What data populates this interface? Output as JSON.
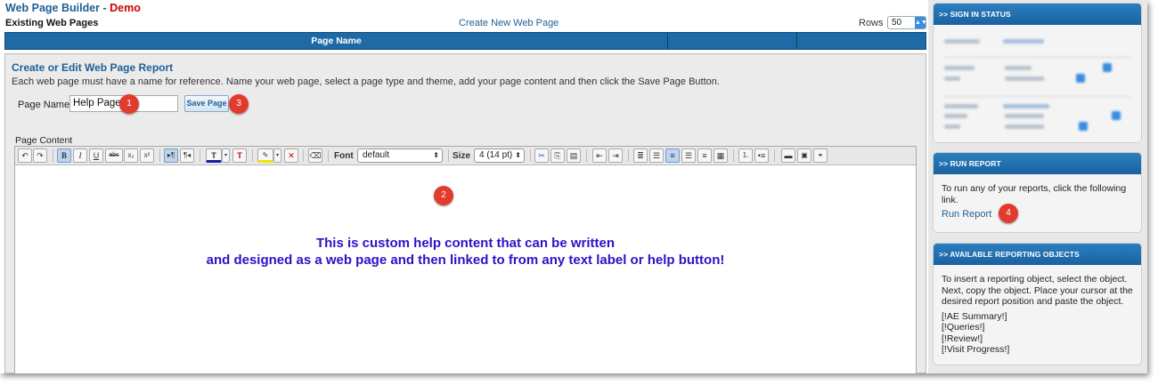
{
  "app": {
    "title": "Web Page Builder",
    "title_sep": " - ",
    "demo_label": "Demo"
  },
  "header": {
    "existing_label": "Existing Web Pages",
    "create_link": "Create New Web Page",
    "rows_label": "Rows",
    "rows_value": "50"
  },
  "table": {
    "columns": [
      "Page Name",
      "",
      ""
    ]
  },
  "panel": {
    "title": "Create or Edit Web Page Report",
    "description": "Each web page must have a name for reference. Name your web page, select a page type and theme, add your page content and then click the Save Page Button.",
    "page_name_label": "Page Name",
    "page_name_value": "Help Page",
    "save_button": "Save Page",
    "page_content_label": "Page Content"
  },
  "editor": {
    "font_label": "Font",
    "font_value": "default",
    "size_label": "Size",
    "size_value": "4 (14 pt)",
    "content_line1": "This is custom help content that can be written",
    "content_line2": "and designed as a web page and then linked to from any text label or help button!"
  },
  "badges": {
    "b1": "1",
    "b2": "2",
    "b3": "3",
    "b4": "4"
  },
  "sidebar": {
    "signin": {
      "title": ">> SIGN IN STATUS"
    },
    "run_report": {
      "title": ">> RUN REPORT",
      "text": "To run any of your reports, click the following link.",
      "link": "Run Report"
    },
    "objects": {
      "title": ">> AVAILABLE REPORTING OBJECTS",
      "text": "To insert a reporting object, select the object. Next, copy the object. Place your cursor at the desired report position and paste the object.",
      "items": [
        "[!AE Summary!]",
        "[!Queries!]",
        "[!Review!]",
        "[!Visit Progress!]"
      ]
    }
  },
  "colors": {
    "brand_blue": "#1e5f96",
    "header_bar": "#1e6aa6",
    "demo_red": "#d00000",
    "badge_red": "#e23b2e",
    "content_text": "#2a12c8"
  },
  "icons": [
    "undo-icon",
    "redo-icon",
    "bold-icon",
    "italic-icon",
    "underline-icon",
    "strikethrough-icon",
    "subscript-icon",
    "superscript-icon",
    "ltr-icon",
    "rtl-icon",
    "text-color-icon",
    "remove-text-color-icon",
    "highlight-icon",
    "remove-highlight-icon",
    "eraser-icon",
    "cut-icon",
    "copy-icon",
    "paste-icon",
    "outdent-icon",
    "indent-icon",
    "align-left-icon",
    "align-center-icon",
    "align-right-icon",
    "justify-icon",
    "ordered-list-icon",
    "unordered-list-icon",
    "horizontal-rule-icon",
    "insert-image-icon"
  ]
}
